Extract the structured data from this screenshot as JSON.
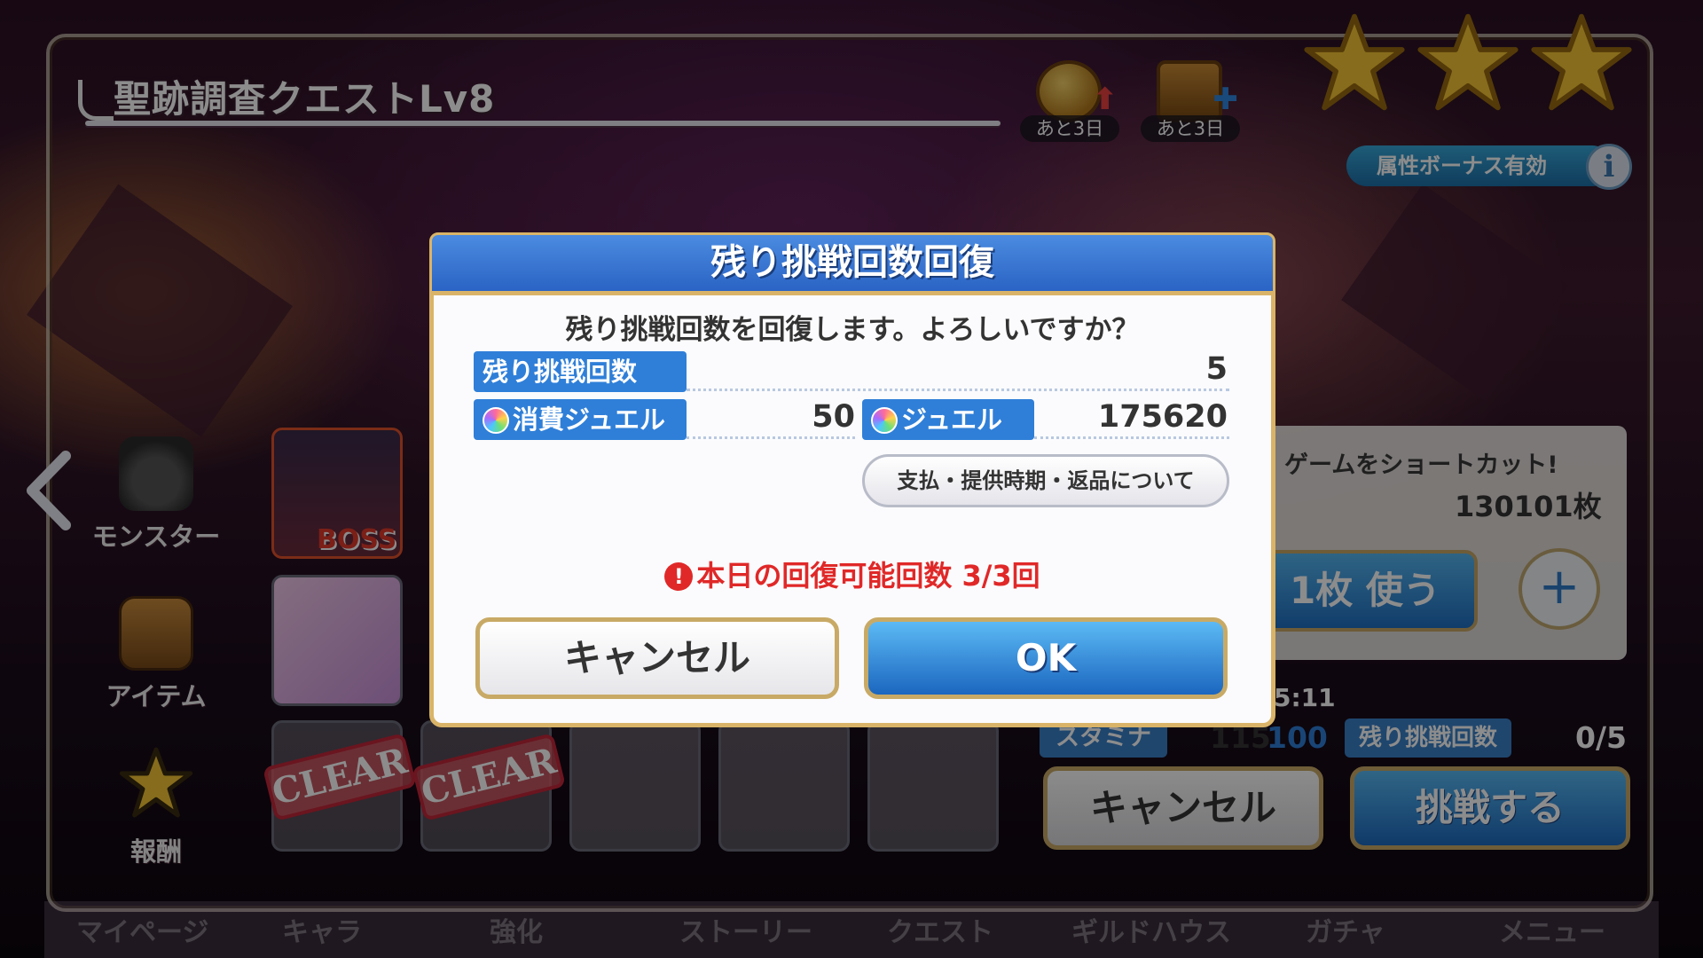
{
  "quest": {
    "title": "聖跡調査クエストLv8",
    "attribute_bonus": "属性ボーナス有効",
    "event_badges": [
      {
        "label": "あと3日",
        "icon": "heart-medal-icon"
      },
      {
        "label": "あと3日",
        "icon": "treasure-chest-icon"
      }
    ],
    "stars": 3
  },
  "side_nav": {
    "items": [
      {
        "label": "モンスター",
        "icon": "monster-icon"
      },
      {
        "label": "アイテム",
        "icon": "chest-icon"
      },
      {
        "label": "報酬",
        "icon": "star-icon"
      }
    ]
  },
  "monster_grid": {
    "boss_label": "BOSS",
    "clear_label": "CLEAR"
  },
  "right_panel": {
    "shortcut_text": "ゲームをショートカット!",
    "ticket_count": "130101枚",
    "use_button": "1枚 使う",
    "time_suffix": "5:11",
    "stamina_label": "スタミナ",
    "stamina_current": "115",
    "stamina_after": "100",
    "challenges_label": "残り挑戦回数",
    "challenges_value": "0/5",
    "cancel_button": "キャンセル",
    "challenge_button": "挑戦する"
  },
  "tab_bar": [
    "マイページ",
    "キャラ",
    "強化",
    "ストーリー",
    "クエスト",
    "ギルドハウス",
    "ガチャ",
    "メニュー"
  ],
  "dialog": {
    "title": "残り挑戦回数回復",
    "message": "残り挑戦回数を回復します。よろしいですか？",
    "remaining_label": "残り挑戦回数",
    "remaining_value": "5",
    "cost_label": "消費ジュエル",
    "cost_value": "50",
    "jewel_label": "ジュエル",
    "jewel_value": "175620",
    "legal_button": "支払・提供時期・返品について",
    "warning": "本日の回復可能回数 3/3回",
    "cancel_button": "キャンセル",
    "ok_button": "OK"
  },
  "colors": {
    "dialog_blue": "#2f7fd8",
    "gold_border": "#d9b468",
    "warning_red": "#e02828"
  }
}
